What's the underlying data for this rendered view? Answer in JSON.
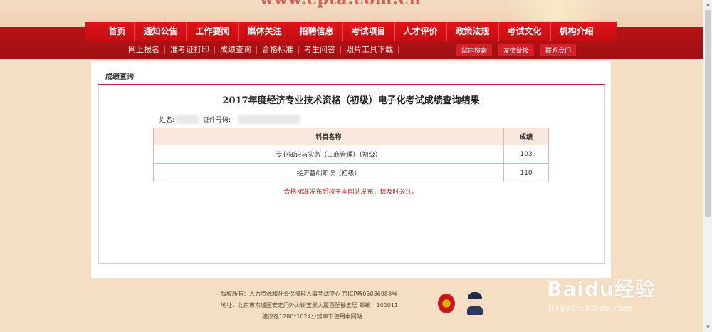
{
  "banner": {
    "url_text": "www.cpta.com.cn"
  },
  "nav": {
    "main": [
      "首页",
      "通知公告",
      "工作要闻",
      "媒体关注",
      "招聘信息",
      "考试项目",
      "人才评价",
      "政策法规",
      "考试文化",
      "机构介绍"
    ],
    "sub": [
      "网上报名",
      "准考证打印",
      "成绩查询",
      "合格标准",
      "考生问答",
      "照片工具下载"
    ],
    "pills": [
      "站内搜索",
      "友情链接",
      "联系我们"
    ]
  },
  "panel": {
    "title": "成绩查询",
    "result_title": "2017年度经济专业技术资格（初级）电子化考试成绩查询结果",
    "name_label": "姓名:",
    "id_label": "证件号码:",
    "table": {
      "headers": [
        "科目名称",
        "成绩"
      ],
      "rows": [
        {
          "subject": "专业知识与实务（工商管理）（初级）",
          "score": "103"
        },
        {
          "subject": "经济基础知识（初级）",
          "score": "110"
        }
      ]
    },
    "notice": "合格标准发布后将于本网站发布，请及时关注。"
  },
  "footer": {
    "line1": "版权所有：人力资源和社会保障部人事考试中心  京ICP备05036988号",
    "line2": "地址：北京市东城区安定门外大街宝景大厦西配楼五层  邮编：100011",
    "line3": "建议在1280*1024分辨率下使用本网站"
  },
  "watermark": {
    "brand": "Baidu经验",
    "url": "jingyan.baidu.com"
  }
}
